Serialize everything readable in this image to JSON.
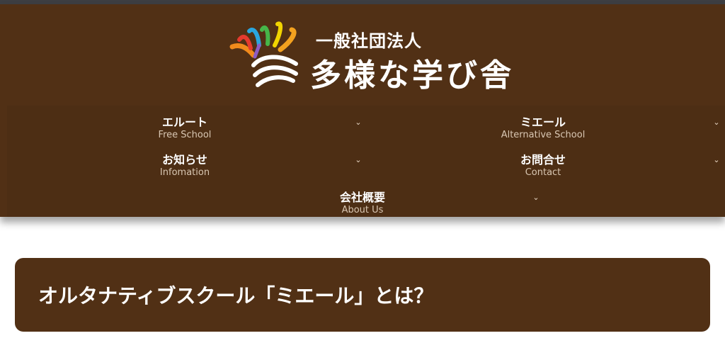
{
  "site": {
    "logo_small": "一般社団法人",
    "logo_big": "多様な学び舎"
  },
  "nav": {
    "items": [
      {
        "label": "エルート",
        "sub": "Free School"
      },
      {
        "label": "ミエール",
        "sub": "Alternative School"
      },
      {
        "label": "お知らせ",
        "sub": "Infomation"
      },
      {
        "label": "お問合せ",
        "sub": "Contact"
      },
      {
        "label": "会社概要",
        "sub": "About Us"
      }
    ],
    "chevron": "⌄"
  },
  "main": {
    "heading": "オルタナティブスクール「ミエール」とは？"
  },
  "colors": {
    "brand_brown": "#513015",
    "topbar": "#3d3e42"
  },
  "icons": {
    "logo": "rainbow-hands-logo-icon",
    "chevron": "chevron-down-icon"
  }
}
